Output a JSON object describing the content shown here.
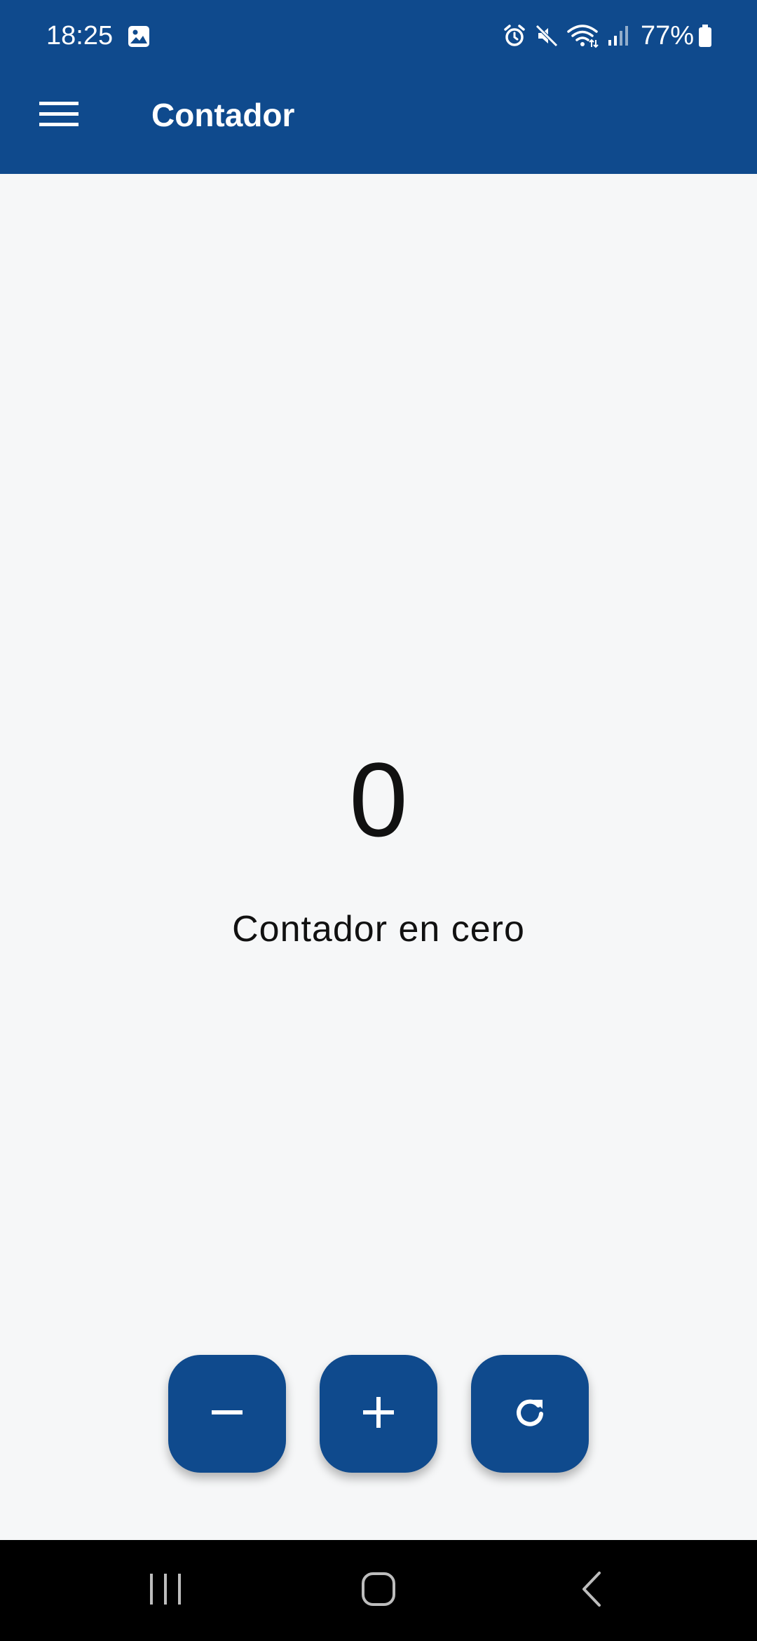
{
  "status_bar": {
    "time": "18:25",
    "battery_percent": "77%",
    "icons": [
      "gallery-icon",
      "alarm-icon",
      "mute-icon",
      "wifi-icon",
      "signal-icon",
      "battery-icon"
    ]
  },
  "app_bar": {
    "title": "Contador",
    "menu_icon": "menu-icon"
  },
  "counter": {
    "value": "0",
    "label": "Contador en cero"
  },
  "actions": [
    {
      "name": "decrement",
      "icon": "minus-icon"
    },
    {
      "name": "increment",
      "icon": "plus-icon"
    },
    {
      "name": "reset",
      "icon": "refresh-icon"
    }
  ],
  "navigation_bar": {
    "icons": [
      "recents-icon",
      "home-icon",
      "back-icon"
    ]
  },
  "colors": {
    "primary": "#0f4a8d",
    "background": "#f6f7f8",
    "text": "#111111",
    "nav_background": "#000000"
  }
}
